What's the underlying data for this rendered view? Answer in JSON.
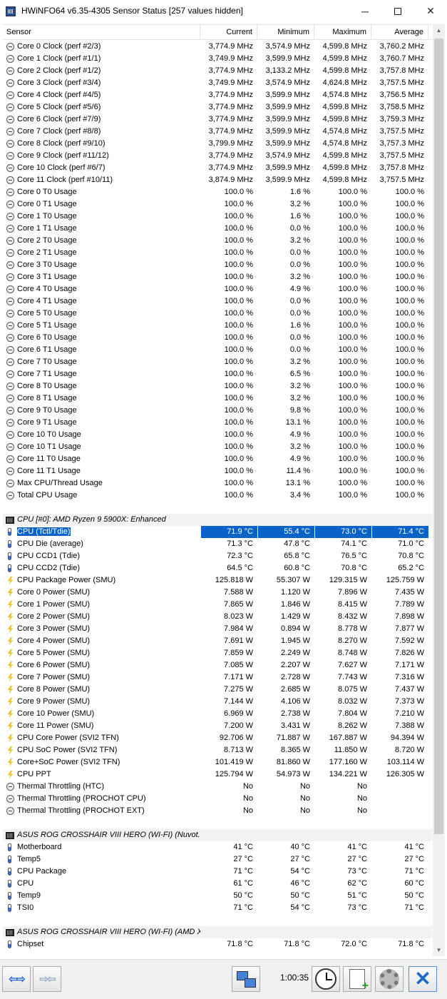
{
  "window": {
    "title": "HWiNFO64 v6.35-4305 Sensor Status [257 values hidden]",
    "min_glyph": "─",
    "close_glyph": "✕"
  },
  "columns": [
    "Sensor",
    "Current",
    "Minimum",
    "Maximum",
    "Average"
  ],
  "rows": [
    {
      "type": "sensor",
      "icon": "clock",
      "name": "Core 0 Clock (perf #2/3)",
      "cur": "3,774.9 MHz",
      "min": "3,574.9 MHz",
      "max": "4,599.8 MHz",
      "avg": "3,760.2 MHz"
    },
    {
      "type": "sensor",
      "icon": "clock",
      "name": "Core 1 Clock (perf #1/1)",
      "cur": "3,749.9 MHz",
      "min": "3,599.9 MHz",
      "max": "4,599.8 MHz",
      "avg": "3,760.7 MHz"
    },
    {
      "type": "sensor",
      "icon": "clock",
      "name": "Core 2 Clock (perf #1/2)",
      "cur": "3,774.9 MHz",
      "min": "3,133.2 MHz",
      "max": "4,599.8 MHz",
      "avg": "3,757.8 MHz"
    },
    {
      "type": "sensor",
      "icon": "clock",
      "name": "Core 3 Clock (perf #3/4)",
      "cur": "3,749.9 MHz",
      "min": "3,574.9 MHz",
      "max": "4,624.8 MHz",
      "avg": "3,757.5 MHz"
    },
    {
      "type": "sensor",
      "icon": "clock",
      "name": "Core 4 Clock (perf #4/5)",
      "cur": "3,774.9 MHz",
      "min": "3,599.9 MHz",
      "max": "4,574.8 MHz",
      "avg": "3,756.5 MHz"
    },
    {
      "type": "sensor",
      "icon": "clock",
      "name": "Core 5 Clock (perf #5/6)",
      "cur": "3,774.9 MHz",
      "min": "3,599.9 MHz",
      "max": "4,599.8 MHz",
      "avg": "3,758.5 MHz"
    },
    {
      "type": "sensor",
      "icon": "clock",
      "name": "Core 6 Clock (perf #7/9)",
      "cur": "3,774.9 MHz",
      "min": "3,599.9 MHz",
      "max": "4,599.8 MHz",
      "avg": "3,759.3 MHz"
    },
    {
      "type": "sensor",
      "icon": "clock",
      "name": "Core 7 Clock (perf #8/8)",
      "cur": "3,774.9 MHz",
      "min": "3,599.9 MHz",
      "max": "4,574.8 MHz",
      "avg": "3,757.5 MHz"
    },
    {
      "type": "sensor",
      "icon": "clock",
      "name": "Core 8 Clock (perf #9/10)",
      "cur": "3,799.9 MHz",
      "min": "3,599.9 MHz",
      "max": "4,574.8 MHz",
      "avg": "3,757.3 MHz"
    },
    {
      "type": "sensor",
      "icon": "clock",
      "name": "Core 9 Clock (perf #11/12)",
      "cur": "3,774.9 MHz",
      "min": "3,574.9 MHz",
      "max": "4,599.8 MHz",
      "avg": "3,757.5 MHz"
    },
    {
      "type": "sensor",
      "icon": "clock",
      "name": "Core 10 Clock (perf #6/7)",
      "cur": "3,774.9 MHz",
      "min": "3,599.9 MHz",
      "max": "4,599.8 MHz",
      "avg": "3,757.8 MHz"
    },
    {
      "type": "sensor",
      "icon": "clock",
      "name": "Core 11 Clock (perf #10/11)",
      "cur": "3,874.9 MHz",
      "min": "3,599.9 MHz",
      "max": "4,599.8 MHz",
      "avg": "3,757.5 MHz"
    },
    {
      "type": "sensor",
      "icon": "clock",
      "name": "Core 0 T0 Usage",
      "cur": "100.0 %",
      "min": "1.6 %",
      "max": "100.0 %",
      "avg": "100.0 %"
    },
    {
      "type": "sensor",
      "icon": "clock",
      "name": "Core 0 T1 Usage",
      "cur": "100.0 %",
      "min": "3.2 %",
      "max": "100.0 %",
      "avg": "100.0 %"
    },
    {
      "type": "sensor",
      "icon": "clock",
      "name": "Core 1 T0 Usage",
      "cur": "100.0 %",
      "min": "1.6 %",
      "max": "100.0 %",
      "avg": "100.0 %"
    },
    {
      "type": "sensor",
      "icon": "clock",
      "name": "Core 1 T1 Usage",
      "cur": "100.0 %",
      "min": "0.0 %",
      "max": "100.0 %",
      "avg": "100.0 %"
    },
    {
      "type": "sensor",
      "icon": "clock",
      "name": "Core 2 T0 Usage",
      "cur": "100.0 %",
      "min": "3.2 %",
      "max": "100.0 %",
      "avg": "100.0 %"
    },
    {
      "type": "sensor",
      "icon": "clock",
      "name": "Core 2 T1 Usage",
      "cur": "100.0 %",
      "min": "0.0 %",
      "max": "100.0 %",
      "avg": "100.0 %"
    },
    {
      "type": "sensor",
      "icon": "clock",
      "name": "Core 3 T0 Usage",
      "cur": "100.0 %",
      "min": "0.0 %",
      "max": "100.0 %",
      "avg": "100.0 %"
    },
    {
      "type": "sensor",
      "icon": "clock",
      "name": "Core 3 T1 Usage",
      "cur": "100.0 %",
      "min": "3.2 %",
      "max": "100.0 %",
      "avg": "100.0 %"
    },
    {
      "type": "sensor",
      "icon": "clock",
      "name": "Core 4 T0 Usage",
      "cur": "100.0 %",
      "min": "4.9 %",
      "max": "100.0 %",
      "avg": "100.0 %"
    },
    {
      "type": "sensor",
      "icon": "clock",
      "name": "Core 4 T1 Usage",
      "cur": "100.0 %",
      "min": "0.0 %",
      "max": "100.0 %",
      "avg": "100.0 %"
    },
    {
      "type": "sensor",
      "icon": "clock",
      "name": "Core 5 T0 Usage",
      "cur": "100.0 %",
      "min": "0.0 %",
      "max": "100.0 %",
      "avg": "100.0 %"
    },
    {
      "type": "sensor",
      "icon": "clock",
      "name": "Core 5 T1 Usage",
      "cur": "100.0 %",
      "min": "1.6 %",
      "max": "100.0 %",
      "avg": "100.0 %"
    },
    {
      "type": "sensor",
      "icon": "clock",
      "name": "Core 6 T0 Usage",
      "cur": "100.0 %",
      "min": "0.0 %",
      "max": "100.0 %",
      "avg": "100.0 %"
    },
    {
      "type": "sensor",
      "icon": "clock",
      "name": "Core 6 T1 Usage",
      "cur": "100.0 %",
      "min": "0.0 %",
      "max": "100.0 %",
      "avg": "100.0 %"
    },
    {
      "type": "sensor",
      "icon": "clock",
      "name": "Core 7 T0 Usage",
      "cur": "100.0 %",
      "min": "3.2 %",
      "max": "100.0 %",
      "avg": "100.0 %"
    },
    {
      "type": "sensor",
      "icon": "clock",
      "name": "Core 7 T1 Usage",
      "cur": "100.0 %",
      "min": "6.5 %",
      "max": "100.0 %",
      "avg": "100.0 %"
    },
    {
      "type": "sensor",
      "icon": "clock",
      "name": "Core 8 T0 Usage",
      "cur": "100.0 %",
      "min": "3.2 %",
      "max": "100.0 %",
      "avg": "100.0 %"
    },
    {
      "type": "sensor",
      "icon": "clock",
      "name": "Core 8 T1 Usage",
      "cur": "100.0 %",
      "min": "3.2 %",
      "max": "100.0 %",
      "avg": "100.0 %"
    },
    {
      "type": "sensor",
      "icon": "clock",
      "name": "Core 9 T0 Usage",
      "cur": "100.0 %",
      "min": "9.8 %",
      "max": "100.0 %",
      "avg": "100.0 %"
    },
    {
      "type": "sensor",
      "icon": "clock",
      "name": "Core 9 T1 Usage",
      "cur": "100.0 %",
      "min": "13.1 %",
      "max": "100.0 %",
      "avg": "100.0 %"
    },
    {
      "type": "sensor",
      "icon": "clock",
      "name": "Core 10 T0 Usage",
      "cur": "100.0 %",
      "min": "4.9 %",
      "max": "100.0 %",
      "avg": "100.0 %"
    },
    {
      "type": "sensor",
      "icon": "clock",
      "name": "Core 10 T1 Usage",
      "cur": "100.0 %",
      "min": "3.2 %",
      "max": "100.0 %",
      "avg": "100.0 %"
    },
    {
      "type": "sensor",
      "icon": "clock",
      "name": "Core 11 T0 Usage",
      "cur": "100.0 %",
      "min": "4.9 %",
      "max": "100.0 %",
      "avg": "100.0 %"
    },
    {
      "type": "sensor",
      "icon": "clock",
      "name": "Core 11 T1 Usage",
      "cur": "100.0 %",
      "min": "11.4 %",
      "max": "100.0 %",
      "avg": "100.0 %"
    },
    {
      "type": "sensor",
      "icon": "clock",
      "name": "Max CPU/Thread Usage",
      "cur": "100.0 %",
      "min": "13.1 %",
      "max": "100.0 %",
      "avg": "100.0 %"
    },
    {
      "type": "sensor",
      "icon": "clock",
      "name": "Total CPU Usage",
      "cur": "100.0 %",
      "min": "3.4 %",
      "max": "100.0 %",
      "avg": "100.0 %"
    },
    {
      "type": "spacer"
    },
    {
      "type": "group",
      "name": "CPU [#0]: AMD Ryzen 9 5900X: Enhanced"
    },
    {
      "type": "sensor",
      "icon": "therm",
      "selected": true,
      "name": "CPU (Tctl/Tdie)",
      "cur": "71.9 °C",
      "min": "55.4 °C",
      "max": "73.0 °C",
      "avg": "71.4 °C"
    },
    {
      "type": "sensor",
      "icon": "therm",
      "name": "CPU Die (average)",
      "cur": "71.3 °C",
      "min": "47.8 °C",
      "max": "74.1 °C",
      "avg": "71.0 °C"
    },
    {
      "type": "sensor",
      "icon": "therm",
      "name": "CPU CCD1 (Tdie)",
      "cur": "72.3 °C",
      "min": "65.8 °C",
      "max": "76.5 °C",
      "avg": "70.8 °C"
    },
    {
      "type": "sensor",
      "icon": "therm",
      "name": "CPU CCD2 (Tdie)",
      "cur": "64.5 °C",
      "min": "60.8 °C",
      "max": "70.8 °C",
      "avg": "65.2 °C"
    },
    {
      "type": "sensor",
      "icon": "power",
      "name": "CPU Package Power (SMU)",
      "cur": "125.818 W",
      "min": "55.307 W",
      "max": "129.315 W",
      "avg": "125.759 W"
    },
    {
      "type": "sensor",
      "icon": "power",
      "name": "Core 0 Power (SMU)",
      "cur": "7.588 W",
      "min": "1.120 W",
      "max": "7.896 W",
      "avg": "7.435 W"
    },
    {
      "type": "sensor",
      "icon": "power",
      "name": "Core 1 Power (SMU)",
      "cur": "7.865 W",
      "min": "1.846 W",
      "max": "8.415 W",
      "avg": "7.789 W"
    },
    {
      "type": "sensor",
      "icon": "power",
      "name": "Core 2 Power (SMU)",
      "cur": "8.023 W",
      "min": "1.429 W",
      "max": "8.432 W",
      "avg": "7.898 W"
    },
    {
      "type": "sensor",
      "icon": "power",
      "name": "Core 3 Power (SMU)",
      "cur": "7.984 W",
      "min": "0.894 W",
      "max": "8.778 W",
      "avg": "7.877 W"
    },
    {
      "type": "sensor",
      "icon": "power",
      "name": "Core 4 Power (SMU)",
      "cur": "7.691 W",
      "min": "1.945 W",
      "max": "8.270 W",
      "avg": "7.592 W"
    },
    {
      "type": "sensor",
      "icon": "power",
      "name": "Core 5 Power (SMU)",
      "cur": "7.859 W",
      "min": "2.249 W",
      "max": "8.748 W",
      "avg": "7.826 W"
    },
    {
      "type": "sensor",
      "icon": "power",
      "name": "Core 6 Power (SMU)",
      "cur": "7.085 W",
      "min": "2.207 W",
      "max": "7.627 W",
      "avg": "7.171 W"
    },
    {
      "type": "sensor",
      "icon": "power",
      "name": "Core 7 Power (SMU)",
      "cur": "7.171 W",
      "min": "2.728 W",
      "max": "7.743 W",
      "avg": "7.316 W"
    },
    {
      "type": "sensor",
      "icon": "power",
      "name": "Core 8 Power (SMU)",
      "cur": "7.275 W",
      "min": "2.685 W",
      "max": "8.075 W",
      "avg": "7.437 W"
    },
    {
      "type": "sensor",
      "icon": "power",
      "name": "Core 9 Power (SMU)",
      "cur": "7.144 W",
      "min": "4.106 W",
      "max": "8.032 W",
      "avg": "7.373 W"
    },
    {
      "type": "sensor",
      "icon": "power",
      "name": "Core 10 Power (SMU)",
      "cur": "6.969 W",
      "min": "2.738 W",
      "max": "7.804 W",
      "avg": "7.210 W"
    },
    {
      "type": "sensor",
      "icon": "power",
      "name": "Core 11 Power (SMU)",
      "cur": "7.200 W",
      "min": "3.431 W",
      "max": "8.262 W",
      "avg": "7.388 W"
    },
    {
      "type": "sensor",
      "icon": "power",
      "name": "CPU Core Power (SVI2 TFN)",
      "cur": "92.706 W",
      "min": "71.887 W",
      "max": "167.887 W",
      "avg": "94.394 W"
    },
    {
      "type": "sensor",
      "icon": "power",
      "name": "CPU SoC Power (SVI2 TFN)",
      "cur": "8.713 W",
      "min": "8.365 W",
      "max": "11.850 W",
      "avg": "8.720 W"
    },
    {
      "type": "sensor",
      "icon": "power",
      "name": "Core+SoC Power (SVI2 TFN)",
      "cur": "101.419 W",
      "min": "81.860 W",
      "max": "177.160 W",
      "avg": "103.114 W"
    },
    {
      "type": "sensor",
      "icon": "power",
      "name": "CPU PPT",
      "cur": "125.794 W",
      "min": "54.973 W",
      "max": "134.221 W",
      "avg": "126.305 W"
    },
    {
      "type": "sensor",
      "icon": "clock",
      "name": "Thermal Throttling (HTC)",
      "cur": "No",
      "min": "No",
      "max": "No",
      "avg": ""
    },
    {
      "type": "sensor",
      "icon": "clock",
      "name": "Thermal Throttling (PROCHOT CPU)",
      "cur": "No",
      "min": "No",
      "max": "No",
      "avg": ""
    },
    {
      "type": "sensor",
      "icon": "clock",
      "name": "Thermal Throttling (PROCHOT EXT)",
      "cur": "No",
      "min": "No",
      "max": "No",
      "avg": ""
    },
    {
      "type": "spacer"
    },
    {
      "type": "group",
      "name": "ASUS ROG CROSSHAIR VIII HERO (WI-FI) (Nuvot..."
    },
    {
      "type": "sensor",
      "icon": "therm",
      "name": "Motherboard",
      "cur": "41 °C",
      "min": "40 °C",
      "max": "41 °C",
      "avg": "41 °C"
    },
    {
      "type": "sensor",
      "icon": "therm",
      "name": "Temp5",
      "cur": "27 °C",
      "min": "27 °C",
      "max": "27 °C",
      "avg": "27 °C"
    },
    {
      "type": "sensor",
      "icon": "therm",
      "name": "CPU Package",
      "cur": "71 °C",
      "min": "54 °C",
      "max": "73 °C",
      "avg": "71 °C"
    },
    {
      "type": "sensor",
      "icon": "therm",
      "name": "CPU",
      "cur": "61 °C",
      "min": "46 °C",
      "max": "62 °C",
      "avg": "60 °C"
    },
    {
      "type": "sensor",
      "icon": "therm",
      "name": "Temp9",
      "cur": "50 °C",
      "min": "50 °C",
      "max": "51 °C",
      "avg": "50 °C"
    },
    {
      "type": "sensor",
      "icon": "therm",
      "name": "TSI0",
      "cur": "71 °C",
      "min": "54 °C",
      "max": "73 °C",
      "avg": "71 °C"
    },
    {
      "type": "spacer"
    },
    {
      "type": "group",
      "name": "ASUS ROG CROSSHAIR VIII HERO (WI-FI) (AMD X..."
    },
    {
      "type": "sensor",
      "icon": "therm",
      "name": "Chipset",
      "cur": "71.8 °C",
      "min": "71.8 °C",
      "max": "72.0 °C",
      "avg": "71.8 °C"
    }
  ],
  "toolbar": {
    "timer": "1:00:35",
    "nav_arrows": "⇦⇨",
    "layout_arrows": "⇨⇦",
    "close_glyph": "✕",
    "icons": [
      "arrows-icon",
      "arrows-layout-icon",
      "network-icon",
      "clock-icon",
      "report-icon",
      "settings-icon",
      "close-icon"
    ]
  },
  "colors": {
    "selection": "#0a64c8",
    "group_bg": "#f2f2f2",
    "toolbar_bg": "#f0f0f0"
  }
}
